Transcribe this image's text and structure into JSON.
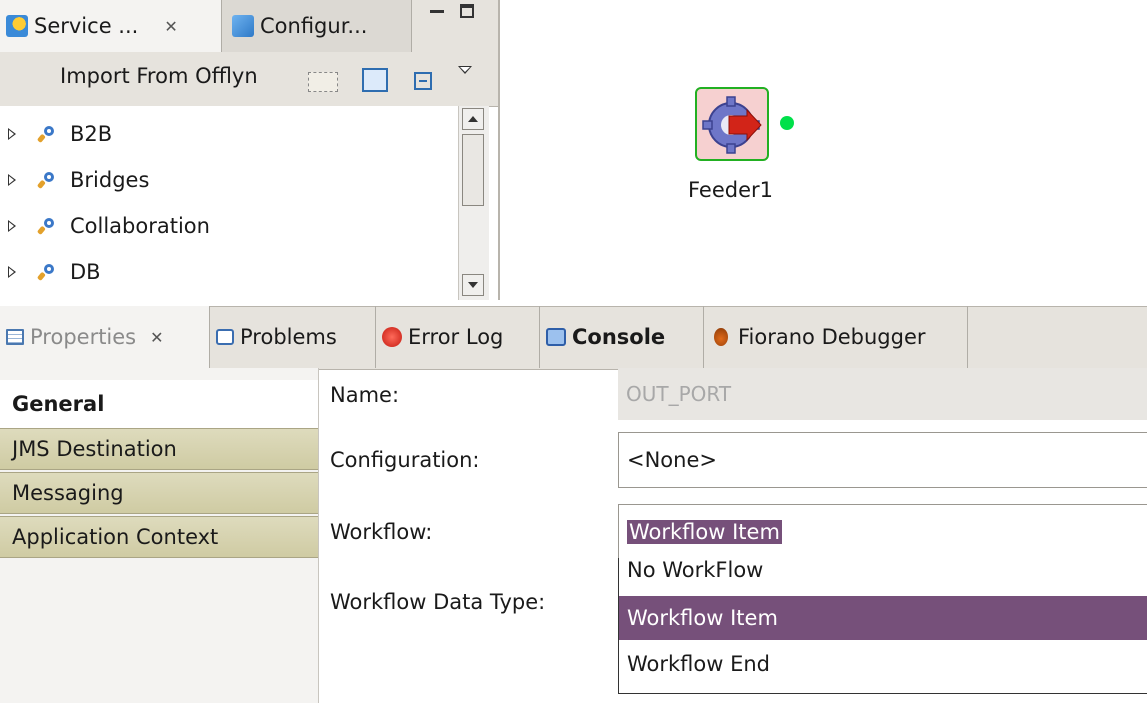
{
  "service_view": {
    "tabs": [
      {
        "label": "Service ...",
        "close": "✕"
      },
      {
        "label": "Configur..."
      }
    ],
    "toolbar_label": "Import From Offlyn",
    "tree_items": [
      "B2B",
      "Bridges",
      "Collaboration",
      "DB"
    ]
  },
  "canvas": {
    "component_label": "Feeder1"
  },
  "bottom_tabs": {
    "properties": "Properties",
    "properties_close": "✕",
    "problems": "Problems",
    "error_log": "Error Log",
    "console": "Console",
    "debugger": "Fiorano Debugger"
  },
  "properties": {
    "nav": {
      "general": "General",
      "items": [
        "JMS Destination",
        "Messaging",
        "Application Context"
      ]
    },
    "labels": {
      "name": "Name:",
      "configuration": "Configuration:",
      "workflow": "Workflow:",
      "workflow_data_type": "Workflow Data Type:"
    },
    "values": {
      "name": "OUT_PORT",
      "configuration": "<None>",
      "workflow": "Workflow Item"
    },
    "workflow_options": [
      "No WorkFlow",
      "Workflow Item",
      "Workflow End"
    ],
    "selected_option_index": 1
  },
  "colors": {
    "selection": "#76507a",
    "nav_item": "#d6d2ae",
    "port_dot": "#00e04a",
    "component_border": "#22b022"
  }
}
